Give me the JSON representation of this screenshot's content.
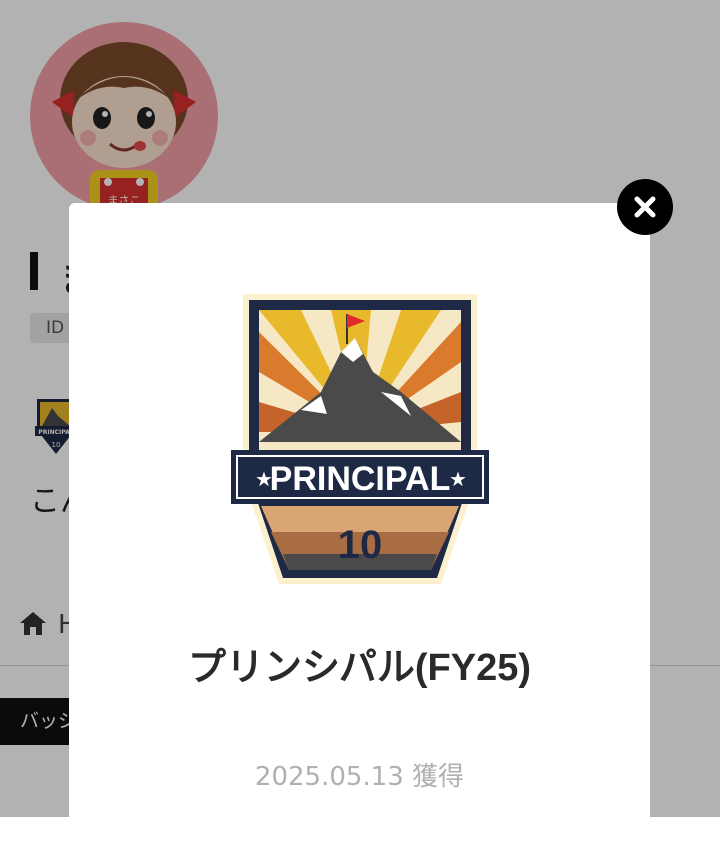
{
  "profile": {
    "avatar_name_tag": "まさこ",
    "name_visible": "ま",
    "id_label": "ID",
    "bio_visible": "こん"
  },
  "nav": {
    "home_label_visible": "H"
  },
  "tabs": {
    "badges_label_visible": "バッジ"
  },
  "modal": {
    "badge_banner_text": "PRINCIPAL",
    "badge_number": "10",
    "title": "プリンシパル(FY25)",
    "earned_text": "2025.05.13 獲得"
  },
  "mini_badge": {
    "banner_text": "PRINCIPAL",
    "number": "10"
  },
  "colors": {
    "overlay": "#000000",
    "badge_navy": "#1e2a45",
    "badge_yellow": "#e9b92c",
    "badge_orange": "#d97a2c",
    "flag_red": "#e02b2b",
    "avatar_bg": "#f2a0a7"
  },
  "icons": {
    "home": "home-icon",
    "close": "close-icon"
  }
}
